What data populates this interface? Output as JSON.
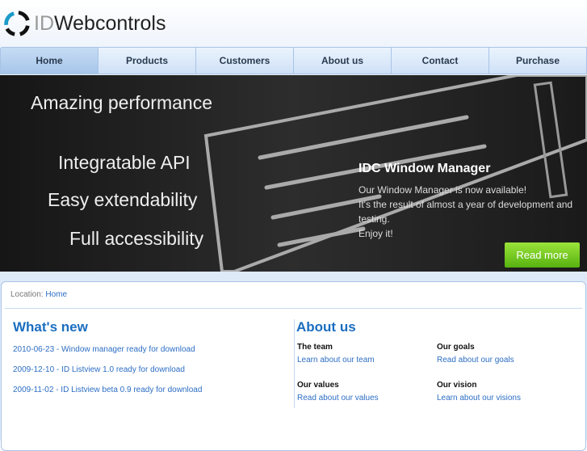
{
  "logo": {
    "id": "ID",
    "rest": "Webcontrols"
  },
  "nav": [
    "Home",
    "Products",
    "Customers",
    "About us",
    "Contact",
    "Purchase"
  ],
  "hero": {
    "features": [
      "Amazing performance",
      "Integratable API",
      "Easy extendability",
      "Full accessibility"
    ],
    "title": "IDC Window Manager",
    "lines": [
      "Our Window Manager is now available!",
      "It's the result of almost a year of development and testing.",
      "Enjoy it!"
    ],
    "button": "Read more"
  },
  "location": {
    "label": "Location:",
    "current": "Home"
  },
  "whats_new": {
    "title": "What's new",
    "items": [
      "2010-06-23 - Window manager ready for download",
      "2009-12-10 - ID Listview 1.0 ready for download",
      "2009-11-02 - ID Listview beta 0.9 ready for download"
    ]
  },
  "about": {
    "title": "About us",
    "sections": [
      {
        "title": "The team",
        "link": "Learn about our team"
      },
      {
        "title": "Our goals",
        "link": "Read about our goals"
      },
      {
        "title": "Our values",
        "link": "Read about our values"
      },
      {
        "title": "Our vision",
        "link": "Learn about our visions"
      }
    ]
  }
}
